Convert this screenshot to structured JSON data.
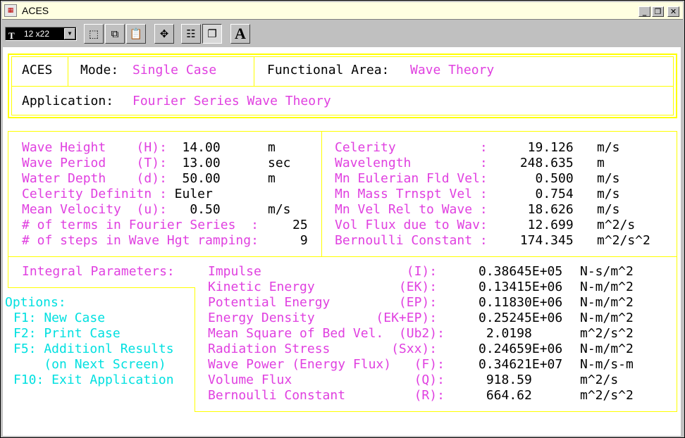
{
  "window": {
    "title": "ACES",
    "controls": [
      "_",
      "❐",
      "✕"
    ]
  },
  "toolbar": {
    "font_label": "12 x22",
    "font_icon": "T",
    "text_button": "A"
  },
  "header": {
    "program": "ACES",
    "mode_label": "Mode:",
    "mode_value": "Single Case",
    "area_label": "Functional Area:",
    "area_value": "Wave Theory",
    "app_label": "Application:",
    "app_value": "Fourier Series Wave Theory"
  },
  "inputs": [
    {
      "label": "Wave Height    (H):",
      "value": "   14.00",
      "unit": "m"
    },
    {
      "label": "Wave Period    (T):",
      "value": "   13.00",
      "unit": "sec"
    },
    {
      "label": "Water Depth    (d):",
      "value": "   50.00",
      "unit": "m"
    },
    {
      "label": "Celerity Definitn :",
      "value": "  Euler",
      "unit": ""
    },
    {
      "label": "Mean Velocity  (u):",
      "value": "    0.50",
      "unit": "m/s"
    },
    {
      "label": "# of terms in Fourier Series  :",
      "value": "25",
      "unit": ""
    },
    {
      "label": "# of steps in Wave Hgt ramping:",
      "value": " 9",
      "unit": ""
    }
  ],
  "outputs": [
    {
      "label": "Celerity           :",
      "value": "  19.126",
      "unit": "m/s"
    },
    {
      "label": "Wavelength         :",
      "value": " 248.635",
      "unit": "m"
    },
    {
      "label": "Mn Eulerian Fld Vel:",
      "value": "   0.500",
      "unit": "m/s"
    },
    {
      "label": "Mn Mass Trnspt Vel :",
      "value": "   0.754",
      "unit": "m/s"
    },
    {
      "label": "Mn Vel Rel to Wave :",
      "value": "  18.626",
      "unit": "m/s"
    },
    {
      "label": "Vol Flux due to Wav:",
      "value": "  12.699",
      "unit": "m^2/s"
    },
    {
      "label": "Bernoulli Constant :",
      "value": " 174.345",
      "unit": "m^2/s^2"
    }
  ],
  "integral": {
    "heading": "Integral Parameters:",
    "rows": [
      {
        "label": "Impulse                   (I):",
        "value": "0.38645E+05",
        "unit": "N-s/m^2"
      },
      {
        "label": "Kinetic Energy           (EK):",
        "value": "0.13415E+06",
        "unit": "N-m/m^2"
      },
      {
        "label": "Potential Energy         (EP):",
        "value": "0.11830E+06",
        "unit": "N-m/m^2"
      },
      {
        "label": "Energy Density        (EK+EP):",
        "value": "0.25245E+06",
        "unit": "N-m/m^2"
      },
      {
        "label": "Mean Square of Bed Vel.  (Ub2):",
        "value": " 2.0198    ",
        "unit": "m^2/s^2"
      },
      {
        "label": "Radiation Stress        (Sxx):",
        "value": "0.24659E+06",
        "unit": "N-m/m^2"
      },
      {
        "label": "Wave Power (Energy Flux)   (F):",
        "value": "0.34621E+07",
        "unit": "N-m/s-m"
      },
      {
        "label": "Volume Flux                (Q):",
        "value": " 918.59    ",
        "unit": "m^2/s"
      },
      {
        "label": "Bernoulli Constant         (R):",
        "value": " 664.62    ",
        "unit": "m^2/s^2"
      }
    ]
  },
  "options": {
    "heading": "Options:",
    "items": [
      "F1: New Case",
      "F2: Print Case",
      "F5: Additionl Results",
      "    (on Next Screen)",
      "F10: Exit Application"
    ]
  },
  "colors": {
    "frame": "#ffff00",
    "label": "#e040e0",
    "value": "#000000",
    "option": "#00e0e0"
  }
}
